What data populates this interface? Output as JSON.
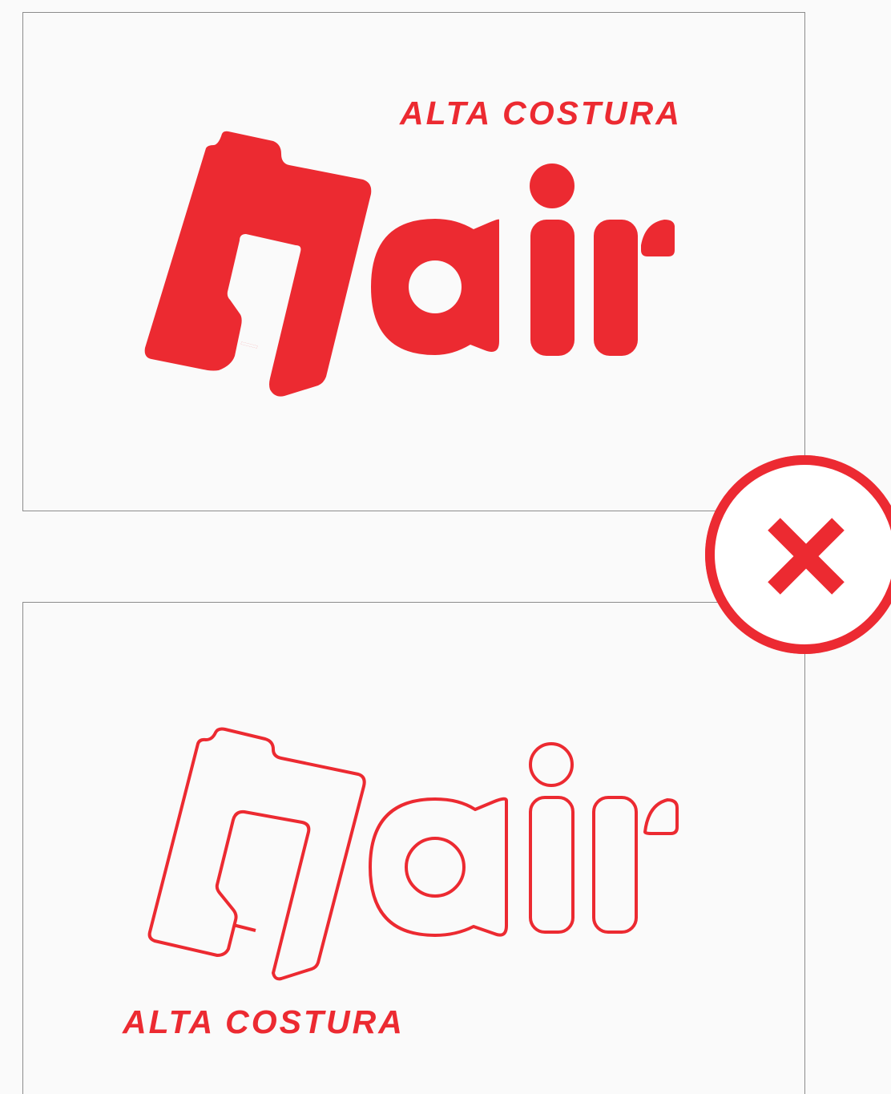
{
  "brand": {
    "tagline_top": "ALTA COSTURA",
    "tagline_bottom": "ALTA COSTURA",
    "color": "#ec2a31"
  },
  "panels": [
    {
      "style": "solid fill",
      "logo_icon": "nair-logo-filled"
    },
    {
      "style": "outline only",
      "logo_icon": "nair-logo-outline"
    }
  ],
  "badge": {
    "icon": "close-x-icon",
    "meaning": "incorrect",
    "color": "#ec2a31"
  }
}
